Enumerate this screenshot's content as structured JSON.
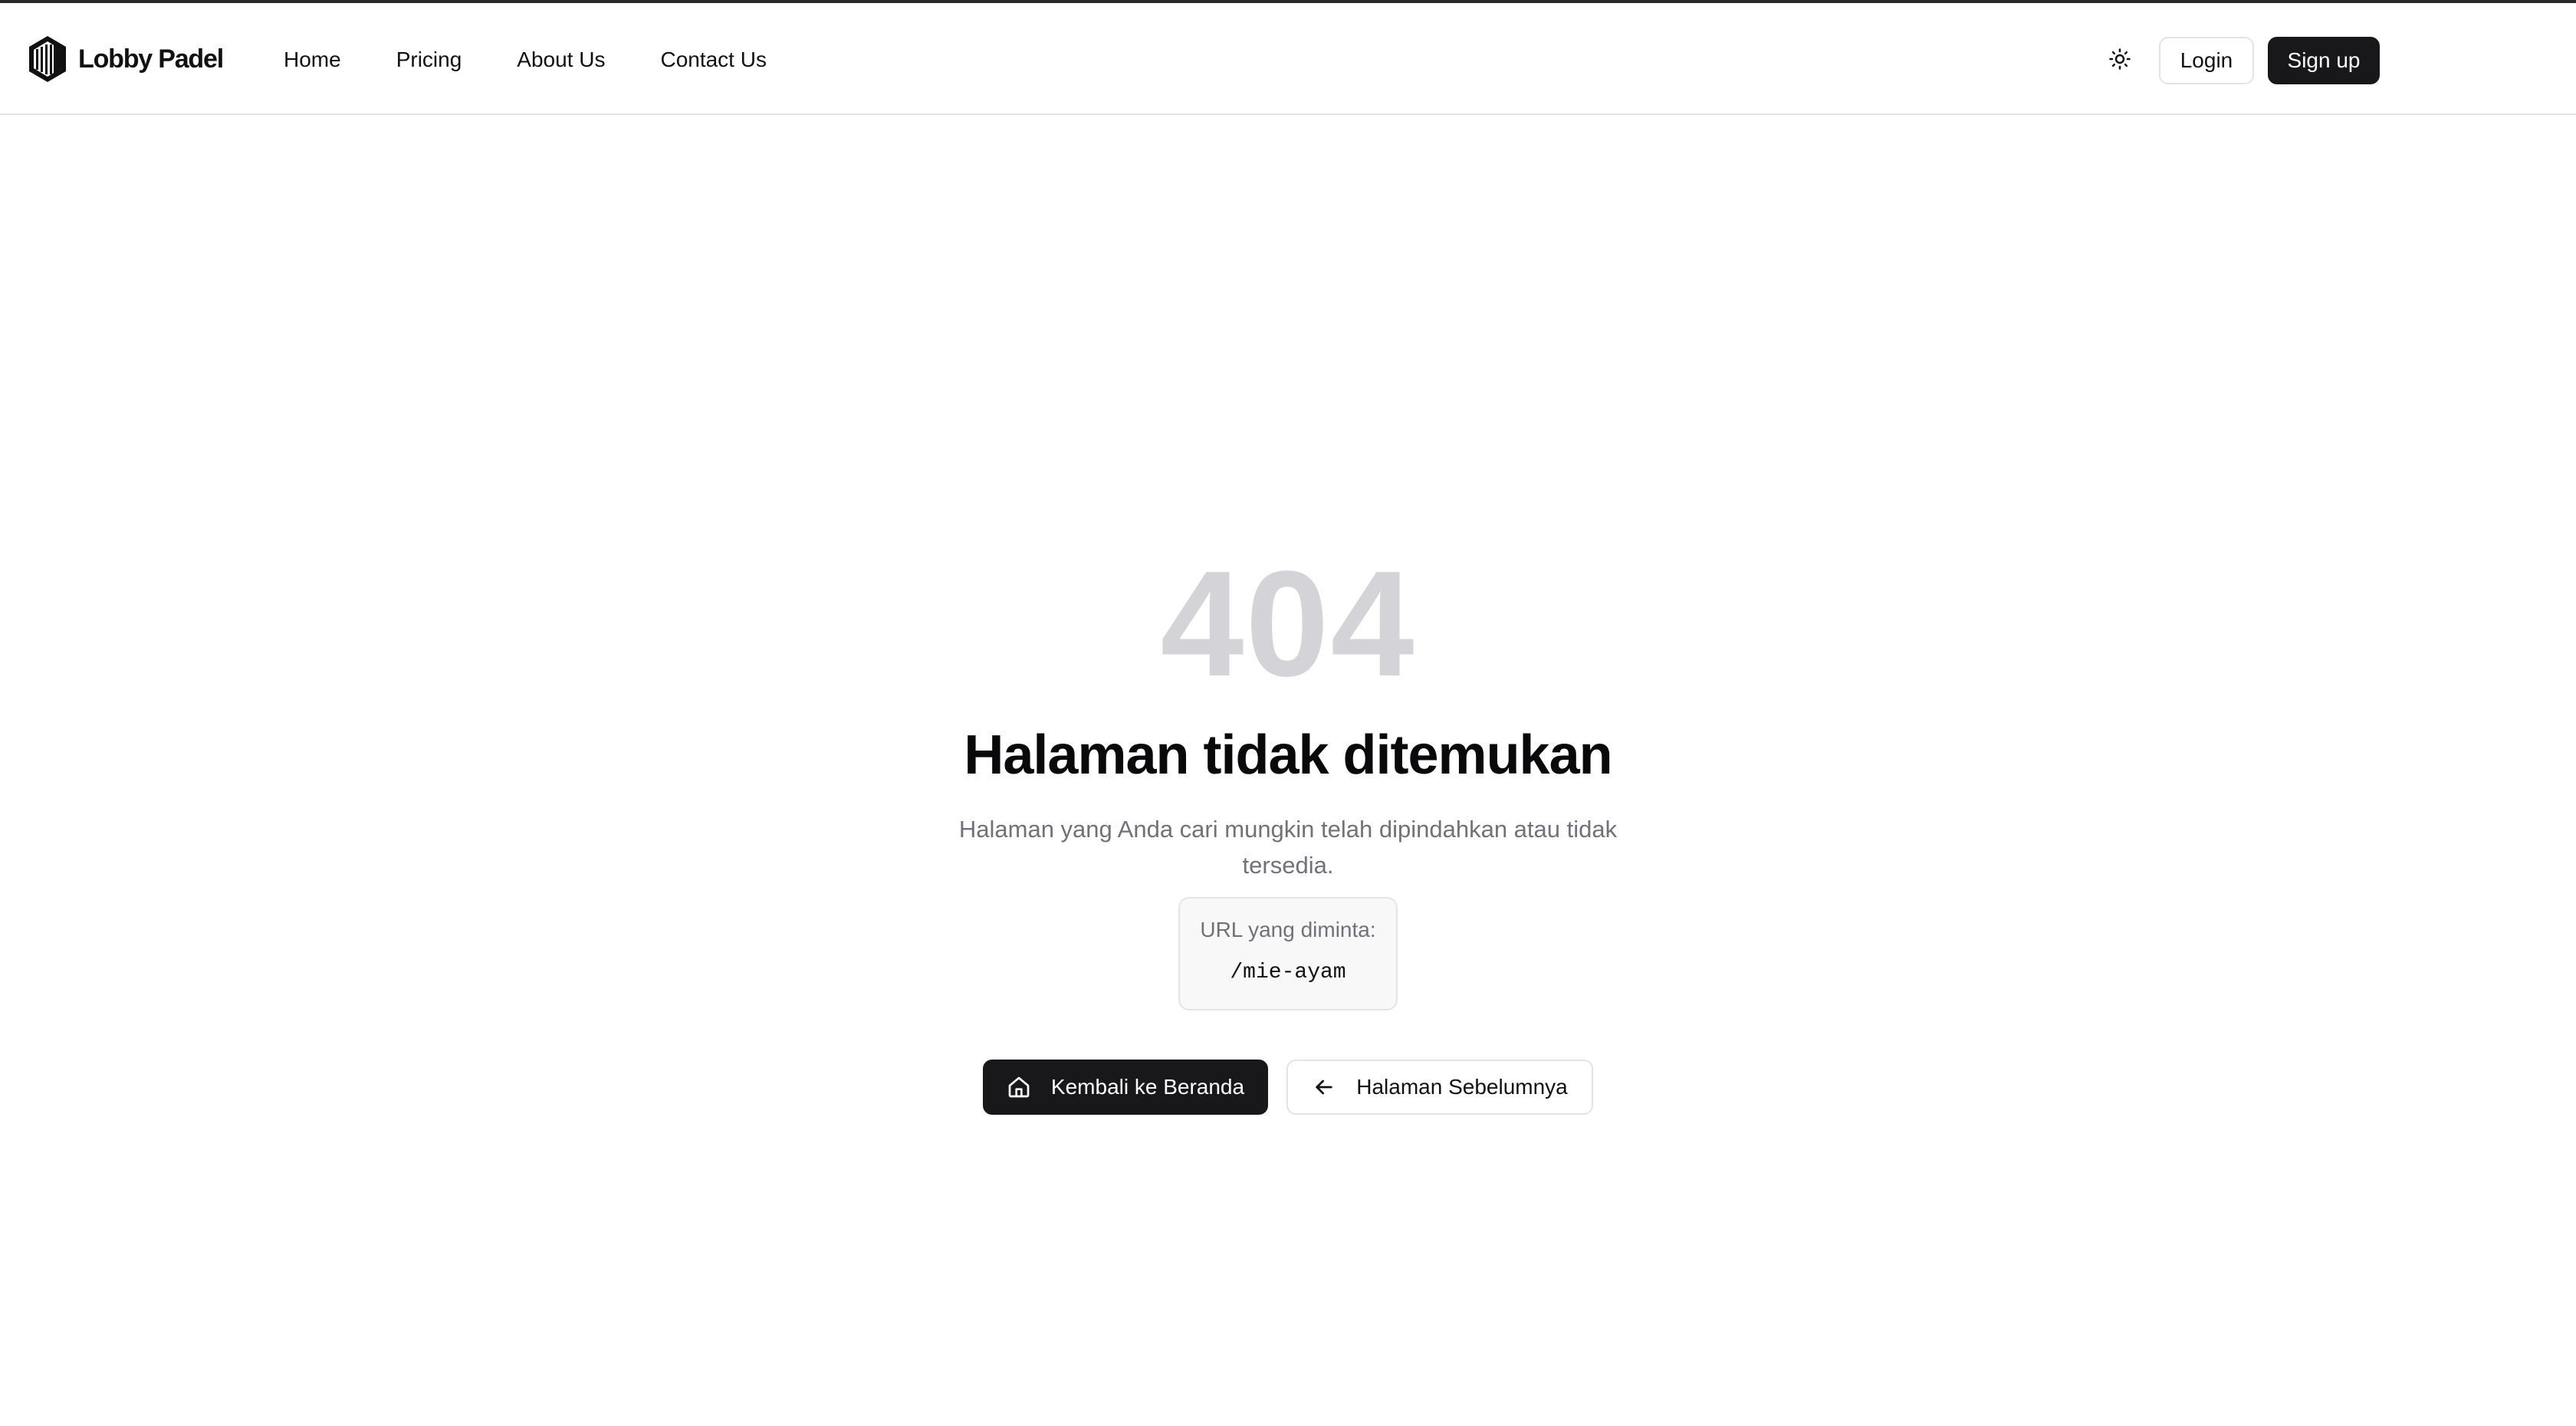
{
  "brand": {
    "name": "Lobby Padel",
    "logo_icon": "lobby-padel-logo-icon"
  },
  "nav": {
    "items": [
      {
        "label": "Home"
      },
      {
        "label": "Pricing"
      },
      {
        "label": "About Us"
      },
      {
        "label": "Contact Us"
      }
    ]
  },
  "header_actions": {
    "theme_toggle_icon": "sun-icon",
    "login_label": "Login",
    "signup_label": "Sign up"
  },
  "error": {
    "code": "404",
    "title": "Halaman tidak ditemukan",
    "description": "Halaman yang Anda cari mungkin telah dipindahkan atau tidak tersedia.",
    "url_label": "URL yang diminta:",
    "url_value": "/mie-ayam"
  },
  "actions": {
    "home_label": "Kembali ke Beranda",
    "home_icon": "home-icon",
    "back_label": "Halaman Sebelumnya",
    "back_icon": "arrow-left-icon"
  },
  "colors": {
    "primary": "#18181b",
    "muted_text": "#71717a",
    "code_text": "#d4d4d8",
    "border": "#e4e4e7"
  }
}
